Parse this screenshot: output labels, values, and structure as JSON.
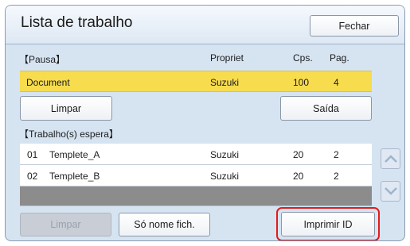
{
  "window": {
    "title": "Lista de trabalho",
    "close_label": "Fechar"
  },
  "paused": {
    "section_label": "【Pausa】",
    "columns": {
      "owner": "Propriet",
      "copies": "Cps.",
      "pages": "Pag."
    },
    "job": {
      "name": "Document",
      "owner": "Suzuki",
      "copies": "100",
      "pages": "4"
    },
    "clear_label": "Limpar",
    "exit_label": "Saída"
  },
  "waiting": {
    "section_label": "【Trabalho(s) espera】",
    "jobs": [
      {
        "index": "01",
        "name": "Templete_A",
        "owner": "Suzuki",
        "copies": "20",
        "pages": "2"
      },
      {
        "index": "02",
        "name": "Templete_B",
        "owner": "Suzuki",
        "copies": "20",
        "pages": "2"
      }
    ]
  },
  "footer": {
    "clear_label": "Limpar",
    "filename_only_label": "Só nome fich.",
    "print_id_label": "Imprimir ID"
  },
  "icons": {
    "scroll_up": "chevron-up-icon",
    "scroll_down": "chevron-down-icon"
  },
  "colors": {
    "highlight": "#e21a1a",
    "paused_row": "#f7dc4e"
  }
}
